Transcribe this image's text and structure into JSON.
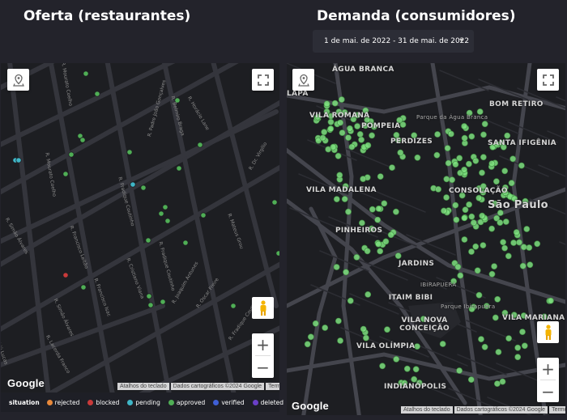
{
  "left_panel": {
    "title": "Oferta (restaurantes)",
    "street_labels": [
      "R. Mourato Coelho",
      "R. Mourato Coelho",
      "R. Simão Álvares",
      "R. Padre João Gonçalves",
      "R. Belmiro Braga",
      "R. Horácio Lane",
      "R. Dr. Virgílio",
      "R. Mateus Grou",
      "R. Fradique Coutinho",
      "R. Fradique Coutinho",
      "R. Francisco Leitão",
      "R. Simão Álvares",
      "R. Francisco Isac",
      "R. Cristiano Viana",
      "R. Joaquim Antunes",
      "R. Lacerda Franco",
      "R. Imbiú Lucas",
      "R. Oscar Freire",
      "R. Fradique Coutinho"
    ],
    "google_logo": "Google",
    "attribution": [
      "Atalhos do teclado",
      "Dados cartográficos ©2024 Google",
      "Termos"
    ],
    "legend": {
      "title": "situation",
      "items": [
        {
          "label": "rejected",
          "color": "#e8893a"
        },
        {
          "label": "blocked",
          "color": "#c93a3a"
        },
        {
          "label": "pending",
          "color": "#3fb6c7"
        },
        {
          "label": "approved",
          "color": "#4fae55"
        },
        {
          "label": "verified",
          "color": "#3f5fd6"
        },
        {
          "label": "deleted",
          "color": "#6a3fc7"
        }
      ]
    }
  },
  "right_panel": {
    "title": "Demanda (consumidores)",
    "date_range": "1 de mai. de 2022 - 31 de mai. de 2022",
    "place_labels": [
      "ÁGUA BRANCA",
      "LAPA",
      "VILA ROMANA",
      "POMPEIA",
      "PERDIZES",
      "BOM RETIRO",
      "SANTA IFIGÊNIA",
      "VILA MADALENA",
      "CONSOLAÇÃO",
      "São Paulo",
      "PINHEIROS",
      "JARDINS",
      "ITAIM BIBI",
      "VILA NOVA CONCEIÇÃO",
      "VILA OLÍMPIA",
      "VILA MARIANA",
      "INDIANÓPOLIS",
      "IBIRAPUERA",
      "Parque Ibirapuera",
      "Parque da Água Branca"
    ],
    "google_logo": "Google",
    "attribution": [
      "Atalhos do teclado",
      "Dados cartográficos ©2024 Google",
      "Termos"
    ]
  },
  "icons": {
    "locate": "location-pin-icon",
    "fullscreen": "fullscreen-icon",
    "pegman": "street-view-pegman-icon",
    "zoom_in": "+",
    "zoom_out": "−"
  },
  "colors": {
    "background": "#23232b",
    "map_bg": "#1d1e22",
    "road": "#34353c",
    "point_green": "#7ee07f"
  }
}
